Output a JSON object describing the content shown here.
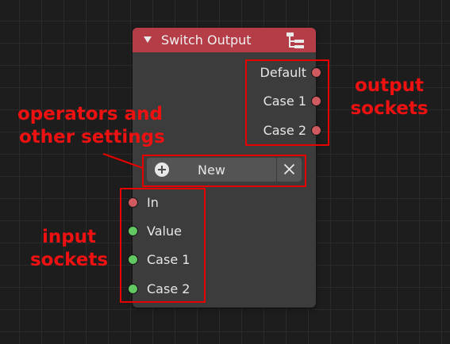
{
  "node": {
    "title": "Switch Output",
    "header_color": "#b53d47",
    "icons": {
      "collapse": "collapse-triangle-icon",
      "type": "node-tree-icon"
    }
  },
  "outputs": [
    {
      "label": "Default",
      "socket_color": "#cf5a5f"
    },
    {
      "label": "Case 1",
      "socket_color": "#cf5a5f"
    },
    {
      "label": "Case 2",
      "socket_color": "#cf5a5f"
    }
  ],
  "operators": {
    "new_label": "New",
    "add_icon": "plus-circle-icon",
    "remove_icon": "close-icon"
  },
  "inputs": [
    {
      "label": "In",
      "socket_color": "#cf5a5f"
    },
    {
      "label": "Value",
      "socket_color": "#62c862"
    },
    {
      "label": "Case 1",
      "socket_color": "#62c862"
    },
    {
      "label": "Case 2",
      "socket_color": "#62c862"
    }
  ],
  "annotations": {
    "output_sockets": [
      "output",
      "sockets"
    ],
    "operators": [
      "operators and",
      "other settings"
    ],
    "input_sockets": [
      "input",
      "sockets"
    ],
    "color": "#ee1111"
  }
}
